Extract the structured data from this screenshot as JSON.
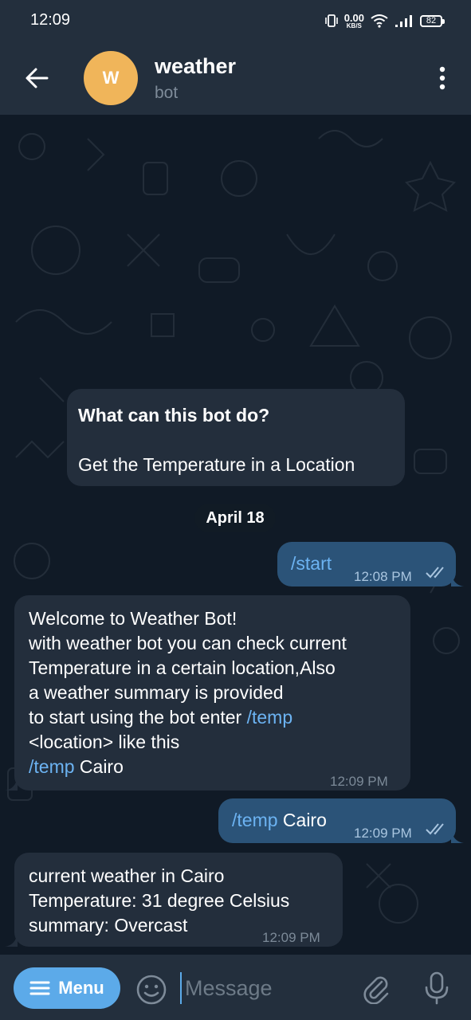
{
  "status_bar": {
    "time": "12:09",
    "net_speed_value": "0.00",
    "net_speed_unit": "KB/S",
    "battery": "82"
  },
  "header": {
    "avatar_letter": "W",
    "title": "weather",
    "subtitle": "bot"
  },
  "bot_intro": {
    "title": "What can this bot do?",
    "body": "Get the Temperature in a Location"
  },
  "date_divider": "April 18",
  "messages": [
    {
      "direction": "outgoing",
      "command": "/start",
      "text": "",
      "time": "12:08 PM"
    },
    {
      "direction": "incoming",
      "lines": [
        "Welcome to Weather Bot!",
        "with weather bot you can check current",
        "Temperature in a certain location,Also",
        "a weather summary is provided"
      ],
      "line5_prefix": "to start using the bot enter ",
      "line5_command": "/temp",
      "line6": "<location> like this",
      "line7_command": "/temp",
      "line7_text": " Cairo",
      "time": "12:09 PM"
    },
    {
      "direction": "outgoing",
      "command": "/temp",
      "text": " Cairo",
      "time": "12:09 PM"
    },
    {
      "direction": "incoming",
      "lines": [
        "current weather in Cairo",
        "Temperature: 31 degree Celsius",
        "summary: Overcast"
      ],
      "time": "12:09 PM"
    }
  ],
  "composer": {
    "menu_label": "Menu",
    "placeholder": "Message"
  },
  "colors": {
    "header_bg": "#232f3d",
    "chat_bg": "#101a26",
    "incoming_bubble": "#232e3c",
    "outgoing_bubble": "#2b5378",
    "accent": "#5caae9",
    "command_link": "#6cb3f2",
    "avatar": "#f0b55a"
  },
  "icons": {
    "back": "arrow-left-icon",
    "more": "more-vertical-icon",
    "read": "double-check-icon",
    "menu": "hamburger-icon",
    "emoji": "smiley-icon",
    "attach": "paperclip-icon",
    "mic": "microphone-icon"
  }
}
